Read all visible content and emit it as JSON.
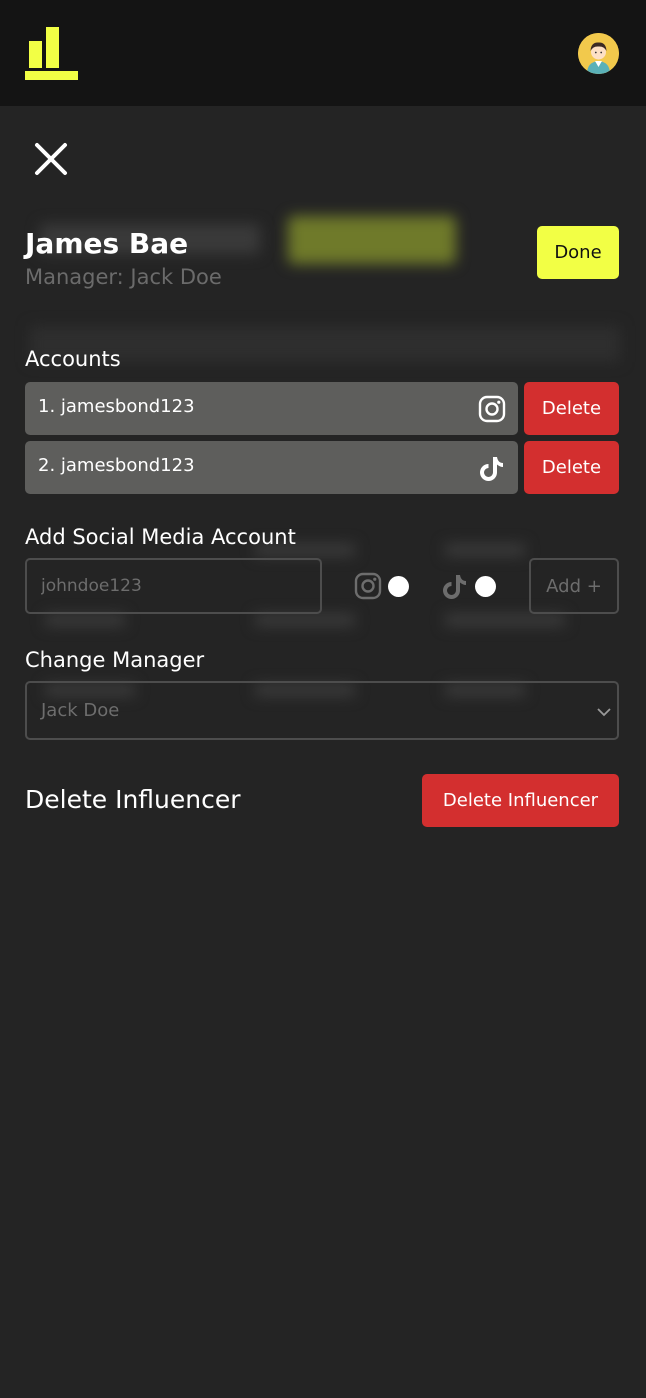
{
  "header": {
    "logo_icon": "bar-chart-logo-icon",
    "avatar_icon": "user-avatar-icon",
    "accent": "#f2ff45"
  },
  "panel": {
    "close_icon": "close-icon",
    "name": "James Bae",
    "manager_line": "Manager: Jack Doe",
    "done_label": "Done"
  },
  "accounts": {
    "label": "Accounts",
    "items": [
      {
        "text": "1. jamesbond123",
        "platform_icon": "instagram-icon",
        "delete_label": "Delete"
      },
      {
        "text": "2. jamesbond123",
        "platform_icon": "tiktok-icon",
        "delete_label": "Delete"
      }
    ]
  },
  "add_account": {
    "label": "Add Social Media Account",
    "placeholder": "johndoe123",
    "options": [
      "instagram-icon",
      "tiktok-icon"
    ],
    "add_label": "Add +"
  },
  "change_manager": {
    "label": "Change Manager",
    "selected": "Jack Doe"
  },
  "delete_influencer": {
    "title": "Delete Influencer",
    "button_label": "Delete Influencer",
    "danger_color": "#d32f2f"
  }
}
